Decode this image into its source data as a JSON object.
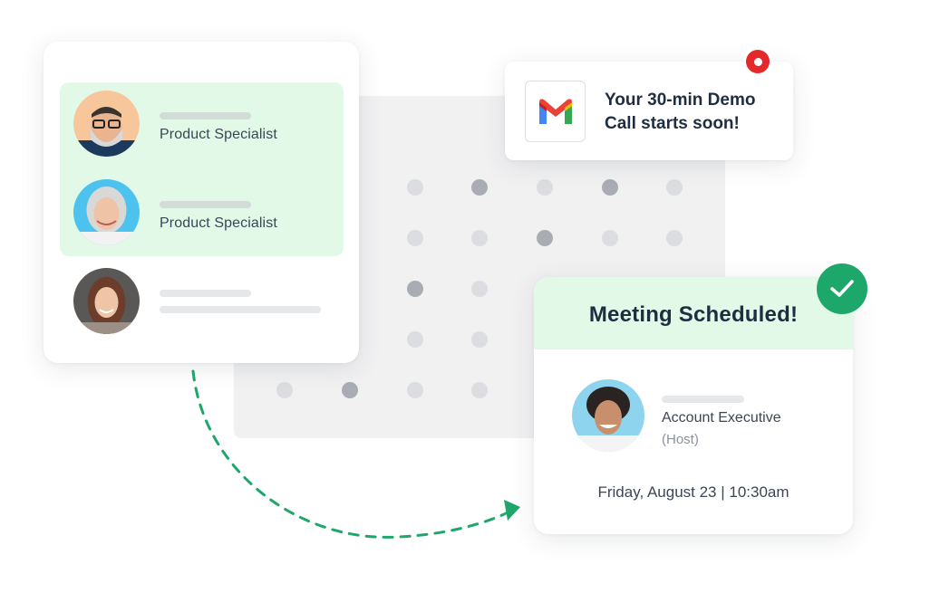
{
  "team": {
    "members": [
      {
        "role": "Product Specialist",
        "avatar": "man-glasses-beard-avatar",
        "highlighted": true
      },
      {
        "role": "Product Specialist",
        "avatar": "woman-grey-hair-avatar",
        "highlighted": true
      },
      {
        "role": "",
        "avatar": "woman-brown-hair-avatar",
        "highlighted": false
      }
    ]
  },
  "notification": {
    "icon": "gmail-icon",
    "text": "Your 30-min Demo Call starts soon!",
    "badge_color": "#e5282b"
  },
  "meeting": {
    "title": "Meeting Scheduled!",
    "host_role": "Account Executive",
    "host_tag": "(Host)",
    "datetime": "Friday, August 23 | 10:30am",
    "status_icon": "check-icon",
    "status_color": "#1ea76a"
  },
  "colors": {
    "accent_green": "#1ea76a",
    "highlight_green": "#e3f9e8",
    "text_dark": "#1f2d40",
    "alert_red": "#e5282b"
  }
}
